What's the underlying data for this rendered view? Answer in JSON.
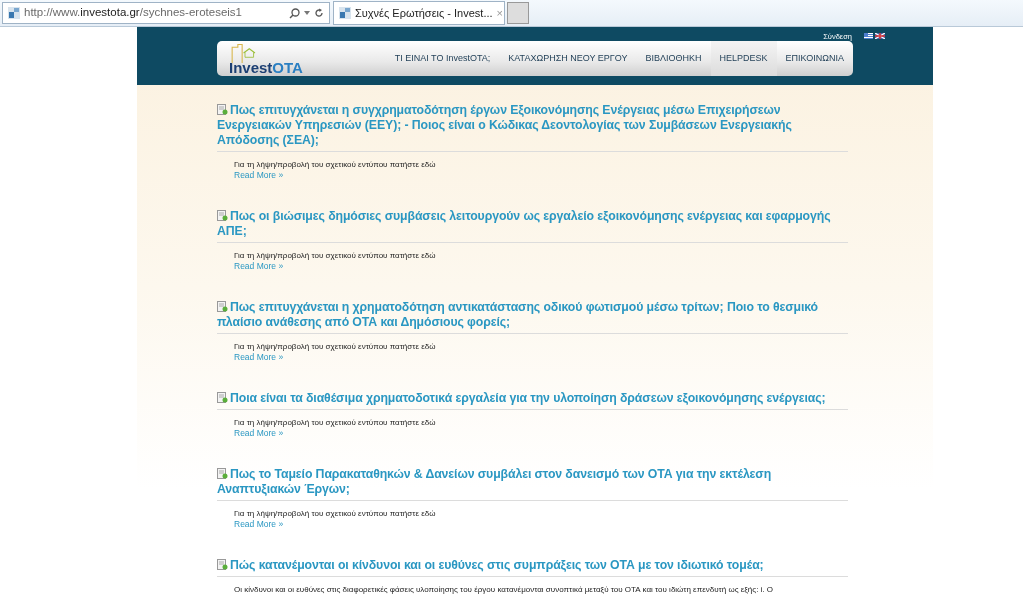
{
  "browser": {
    "url": "http://www.**investota.gr**/sychnes-eroteseis1",
    "tab_title": "Συχνές Ερωτήσεις - Invest...",
    "tab_close": "×"
  },
  "header": {
    "login": "Σύνδεση",
    "logo": [
      "Invest",
      "OTA"
    ],
    "nav": [
      {
        "label": "ΤΙ ΕΙΝΑΙ ΤΟ InvestOTA;",
        "selected": false
      },
      {
        "label": "ΚΑΤΑΧΩΡΗΣΗ ΝΕΟΥ ΕΡΓΟΥ",
        "selected": false
      },
      {
        "label": "ΒΙΒΛΙΟΘΗΚΗ",
        "selected": false
      },
      {
        "label": "HELPDESK",
        "selected": true
      },
      {
        "label": "ΕΠΙΚΟΙΝΩΝΙΑ",
        "selected": false
      }
    ]
  },
  "articles": [
    {
      "title": "Πως επιτυγχάνεται η συγχρηματοδότηση έργων Εξοικονόμησης Ενέργειας μέσω Επιχειρήσεων Ενεργειακών Υπηρεσιών (ΕΕΥ); - Ποιος είναι ο Κώδικας Δεοντολογίας των Συμβάσεων Ενεργειακής Απόδοσης (ΣΕΑ);",
      "body": "Για τη λήψη/προβολή του σχετικού εντύπου πατήστε  εδώ",
      "read_more": "Read More »"
    },
    {
      "title": "Πως οι βιώσιμες δημόσιες συμβάσεις λειτουργούν ως εργαλείο εξοικονόμησης ενέργειας και εφαρμογής ΑΠΕ;",
      "body": "Για τη λήψη/προβολή του σχετικού εντύπου πατήστε  εδώ",
      "read_more": "Read More »"
    },
    {
      "title": "Πως επιτυγχάνεται η χρηματοδότηση αντικατάστασης οδικού φωτισμού μέσω τρίτων; Ποιο το θεσμικό πλαίσιο ανάθεσης από ΟΤΑ και Δημόσιους φορείς;",
      "body": "Για τη λήψη/προβολή του σχετικού εντύπου πατήστε  εδώ",
      "read_more": "Read More »"
    },
    {
      "title": "Ποια είναι τα διαθέσιμα χρηματοδοτικά εργαλεία για την υλοποίηση δράσεων εξοικονόμησης ενέργειας;",
      "body": "Για τη λήψη/προβολή του σχετικού εντύπου πατήστε  εδώ",
      "read_more": "Read More »"
    },
    {
      "title": "Πως το Ταμείο Παρακαταθηκών & Δανείων συμβάλει στον δανεισμό των ΟΤΑ για την εκτέλεση Αναπτυξιακών Έργων;",
      "body": "Για τη λήψη/προβολή του σχετικού εντύπου πατήστε  εδώ",
      "read_more": "Read More »"
    },
    {
      "title": "Πώς κατανέμονται οι κίνδυνοι και οι ευθύνες στις συμπράξεις των ΟΤΑ με τον ιδιωτικό τομέα;",
      "body": "Οι κίνδυνοι και οι ευθύνες στις διαφορετικές φάσεις υλοποίησης του έργου κατανέμονται συνοπτικά μεταξύ του ΟΤΑ και του ιδιώτη επενδυτή ως εξής:  i. Ο"
    }
  ]
}
